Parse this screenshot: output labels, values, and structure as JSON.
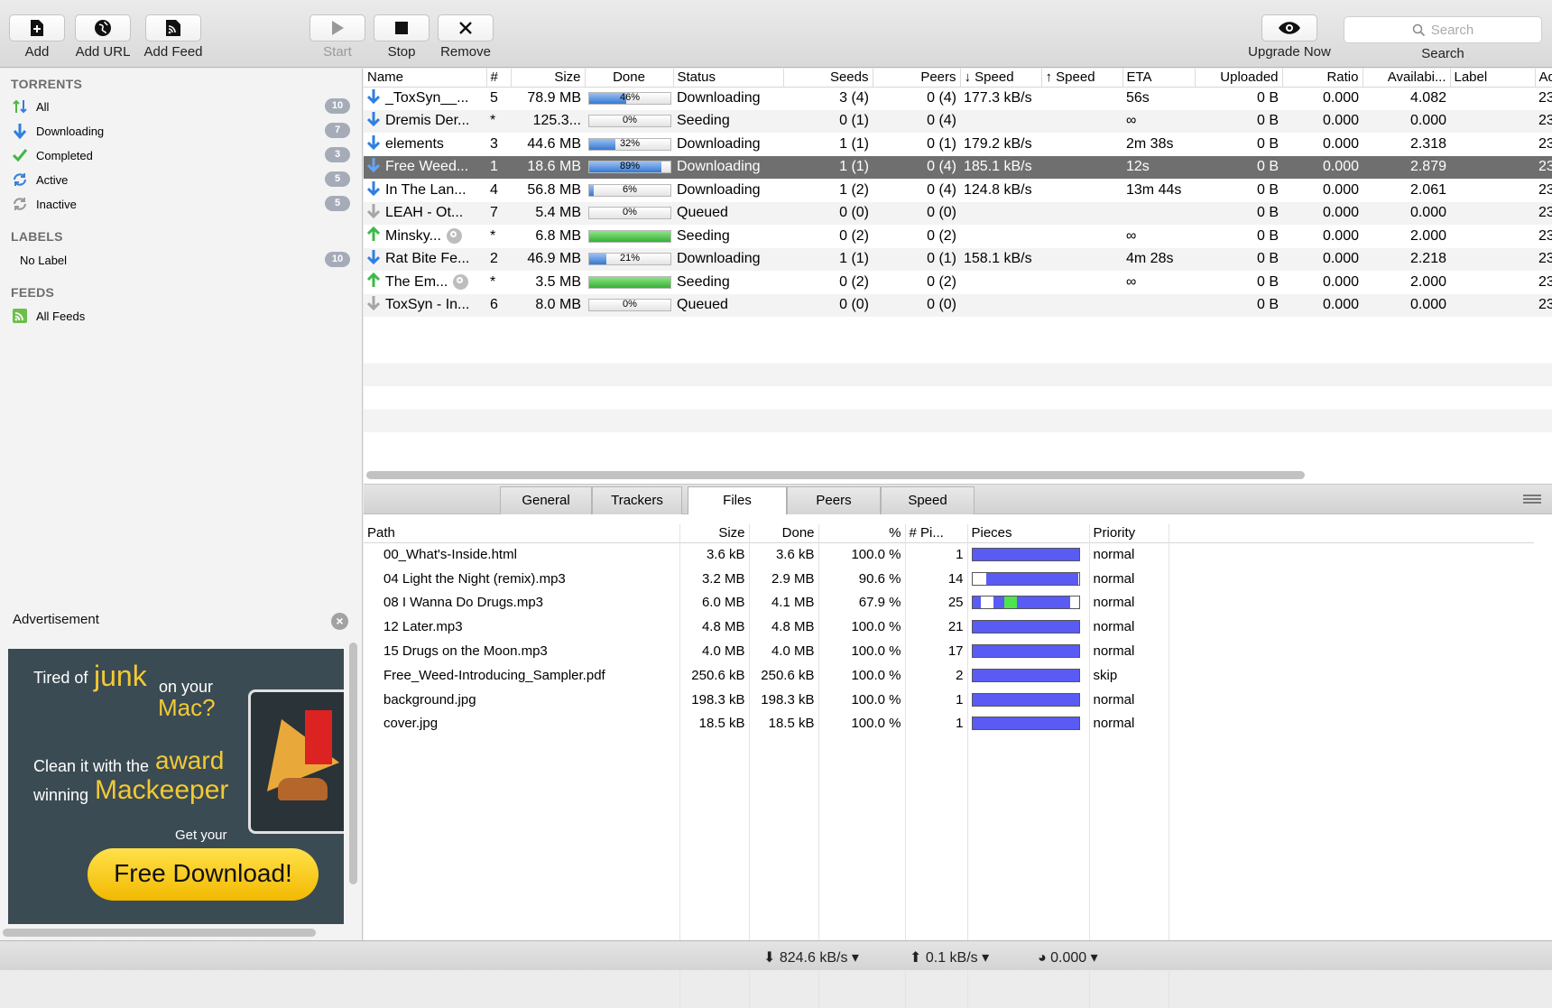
{
  "toolbar": {
    "add": "Add",
    "add_url": "Add URL",
    "add_feed": "Add Feed",
    "start": "Start",
    "stop": "Stop",
    "remove": "Remove",
    "upgrade": "Upgrade Now",
    "search_placeholder": "Search",
    "search_label": "Search"
  },
  "sidebar": {
    "torrents_header": "TORRENTS",
    "torrents": [
      {
        "label": "All",
        "count": "10",
        "icon": "updown-arrows-icon"
      },
      {
        "label": "Downloading",
        "count": "7",
        "icon": "down-arrow-icon"
      },
      {
        "label": "Completed",
        "count": "3",
        "icon": "checkmark-icon"
      },
      {
        "label": "Active",
        "count": "5",
        "icon": "refresh-icon"
      },
      {
        "label": "Inactive",
        "count": "5",
        "icon": "refresh-icon"
      }
    ],
    "labels_header": "LABELS",
    "labels": [
      {
        "label": "No Label",
        "count": "10"
      }
    ],
    "feeds_header": "FEEDS",
    "feeds": [
      {
        "label": "All Feeds",
        "icon": "rss-icon"
      }
    ]
  },
  "ad": {
    "title": "Advertisement",
    "line1a": "Tired of",
    "line1b": "junk",
    "line1c": "on your",
    "line2": "Mac?",
    "line3a": "Clean it with the",
    "line3b": "award",
    "line4a": "winning",
    "line4b": "Mackeeper",
    "line5": "Get your",
    "cta": "Free Download!"
  },
  "torrent_table": {
    "columns": [
      "Name",
      "#",
      "Size",
      "Done",
      "Status",
      "Seeds",
      "Peers",
      "↓ Speed",
      "↑ Speed",
      "ETA",
      "Uploaded",
      "Ratio",
      "Availabi...",
      "Label",
      "Ad"
    ],
    "rows": [
      {
        "name": "_ToxSyn__...",
        "num": "5",
        "size": "78.9 MB",
        "done": 46,
        "done_label": "46%",
        "status": "Downloading",
        "seeds": "3 (4)",
        "peers": "0 (4)",
        "down": "177.3 kB/s",
        "up": "",
        "eta": "56s",
        "uploaded": "0 B",
        "ratio": "0.000",
        "avail": "4.082",
        "label": "",
        "added": "23",
        "dir": "down",
        "mag": false
      },
      {
        "name": "Dremis Der...",
        "num": "*",
        "size": "125.3...",
        "done": 0,
        "done_label": "0%",
        "status": "Seeding",
        "seeds": "0 (1)",
        "peers": "0 (4)",
        "down": "",
        "up": "",
        "eta": "∞",
        "uploaded": "0 B",
        "ratio": "0.000",
        "avail": "0.000",
        "label": "",
        "added": "23",
        "dir": "down",
        "mag": false
      },
      {
        "name": "elements",
        "num": "3",
        "size": "44.6 MB",
        "done": 32,
        "done_label": "32%",
        "status": "Downloading",
        "seeds": "1 (1)",
        "peers": "0 (1)",
        "down": "179.2 kB/s",
        "up": "",
        "eta": "2m 38s",
        "uploaded": "0 B",
        "ratio": "0.000",
        "avail": "2.318",
        "label": "",
        "added": "23",
        "dir": "down",
        "mag": false
      },
      {
        "name": "Free Weed...",
        "num": "1",
        "size": "18.6 MB",
        "done": 89,
        "done_label": "89%",
        "status": "Downloading",
        "seeds": "1 (1)",
        "peers": "0 (4)",
        "down": "185.1 kB/s",
        "up": "",
        "eta": "12s",
        "uploaded": "0 B",
        "ratio": "0.000",
        "avail": "2.879",
        "label": "",
        "added": "23",
        "dir": "down",
        "mag": false,
        "selected": true
      },
      {
        "name": "In The Lan...",
        "num": "4",
        "size": "56.8 MB",
        "done": 6,
        "done_label": "6%",
        "status": "Downloading",
        "seeds": "1 (2)",
        "peers": "0 (4)",
        "down": "124.8 kB/s",
        "up": "",
        "eta": "13m 44s",
        "uploaded": "0 B",
        "ratio": "0.000",
        "avail": "2.061",
        "label": "",
        "added": "23",
        "dir": "down",
        "mag": false
      },
      {
        "name": "LEAH - Ot...",
        "num": "7",
        "size": "5.4 MB",
        "done": 0,
        "done_label": "0%",
        "status": "Queued",
        "seeds": "0 (0)",
        "peers": "0 (0)",
        "down": "",
        "up": "",
        "eta": "",
        "uploaded": "0 B",
        "ratio": "0.000",
        "avail": "0.000",
        "label": "",
        "added": "23",
        "dir": "queued",
        "mag": false
      },
      {
        "name": "Minsky...",
        "num": "*",
        "size": "6.8 MB",
        "done": 100,
        "done_label": "",
        "status": "Seeding",
        "seeds": "0 (2)",
        "peers": "0 (2)",
        "down": "",
        "up": "",
        "eta": "∞",
        "uploaded": "0 B",
        "ratio": "0.000",
        "avail": "2.000",
        "label": "",
        "added": "23",
        "dir": "up",
        "mag": true
      },
      {
        "name": "Rat Bite Fe...",
        "num": "2",
        "size": "46.9 MB",
        "done": 21,
        "done_label": "21%",
        "status": "Downloading",
        "seeds": "1 (1)",
        "peers": "0 (1)",
        "down": "158.1 kB/s",
        "up": "",
        "eta": "4m 28s",
        "uploaded": "0 B",
        "ratio": "0.000",
        "avail": "2.218",
        "label": "",
        "added": "23",
        "dir": "down",
        "mag": false
      },
      {
        "name": "The Em...",
        "num": "*",
        "size": "3.5 MB",
        "done": 100,
        "done_label": "",
        "status": "Seeding",
        "seeds": "0 (2)",
        "peers": "0 (2)",
        "down": "",
        "up": "",
        "eta": "∞",
        "uploaded": "0 B",
        "ratio": "0.000",
        "avail": "2.000",
        "label": "",
        "added": "23",
        "dir": "up",
        "mag": true
      },
      {
        "name": "ToxSyn - In...",
        "num": "6",
        "size": "8.0 MB",
        "done": 0,
        "done_label": "0%",
        "status": "Queued",
        "seeds": "0 (0)",
        "peers": "0 (0)",
        "down": "",
        "up": "",
        "eta": "",
        "uploaded": "0 B",
        "ratio": "0.000",
        "avail": "0.000",
        "label": "",
        "added": "23",
        "dir": "queued",
        "mag": false
      }
    ]
  },
  "detail_tabs": [
    {
      "label": "General"
    },
    {
      "label": "Trackers"
    },
    {
      "label": "Files",
      "active": true
    },
    {
      "label": "Peers"
    },
    {
      "label": "Speed"
    }
  ],
  "files_table": {
    "columns": [
      "Path",
      "Size",
      "Done",
      "%",
      "# Pi...",
      "Pieces",
      "Priority"
    ],
    "rows": [
      {
        "path": "00_What's-Inside.html",
        "size": "3.6 kB",
        "done": "3.6 kB",
        "pct": "100.0 %",
        "pieces": "1",
        "priority": "normal",
        "pieces_map": [
          [
            0,
            1,
            "blue"
          ]
        ]
      },
      {
        "path": "04 Light the Night (remix).mp3",
        "size": "3.2 MB",
        "done": "2.9 MB",
        "pct": "90.6 %",
        "pieces": "14",
        "priority": "normal",
        "pieces_map": [
          [
            0.13,
            1,
            "blue"
          ]
        ]
      },
      {
        "path": "08 I Wanna Do Drugs.mp3",
        "size": "6.0 MB",
        "done": "4.1 MB",
        "pct": "67.9 %",
        "pieces": "25",
        "priority": "normal",
        "pieces_map": [
          [
            0,
            0.08,
            "blue"
          ],
          [
            0.2,
            0.3,
            "blue"
          ],
          [
            0.3,
            0.42,
            "green"
          ],
          [
            0.42,
            0.92,
            "blue"
          ]
        ]
      },
      {
        "path": "12 Later.mp3",
        "size": "4.8 MB",
        "done": "4.8 MB",
        "pct": "100.0 %",
        "pieces": "21",
        "priority": "normal",
        "pieces_map": [
          [
            0,
            1,
            "blue"
          ]
        ]
      },
      {
        "path": "15 Drugs on the Moon.mp3",
        "size": "4.0 MB",
        "done": "4.0 MB",
        "pct": "100.0 %",
        "pieces": "17",
        "priority": "normal",
        "pieces_map": [
          [
            0,
            1,
            "blue"
          ]
        ]
      },
      {
        "path": "Free_Weed-Introducing_Sampler.pdf",
        "size": "250.6 kB",
        "done": "250.6 kB",
        "pct": "100.0 %",
        "pieces": "2",
        "priority": "skip",
        "pieces_map": [
          [
            0,
            1,
            "blue"
          ]
        ]
      },
      {
        "path": "background.jpg",
        "size": "198.3 kB",
        "done": "198.3 kB",
        "pct": "100.0 %",
        "pieces": "1",
        "priority": "normal",
        "pieces_map": [
          [
            0,
            1,
            "blue"
          ]
        ]
      },
      {
        "path": "cover.jpg",
        "size": "18.5 kB",
        "done": "18.5 kB",
        "pct": "100.0 %",
        "pieces": "1",
        "priority": "normal",
        "pieces_map": [
          [
            0,
            1,
            "blue"
          ]
        ]
      }
    ]
  },
  "statusbar": {
    "down": "824.6 kB/s",
    "up": "0.1 kB/s",
    "ratio": "0.000"
  },
  "colors": {
    "piece_blue": "#5a5af5",
    "piece_green": "#4fe34f",
    "selected_row": "#6f6f6f",
    "badge": "#a5acb8"
  }
}
